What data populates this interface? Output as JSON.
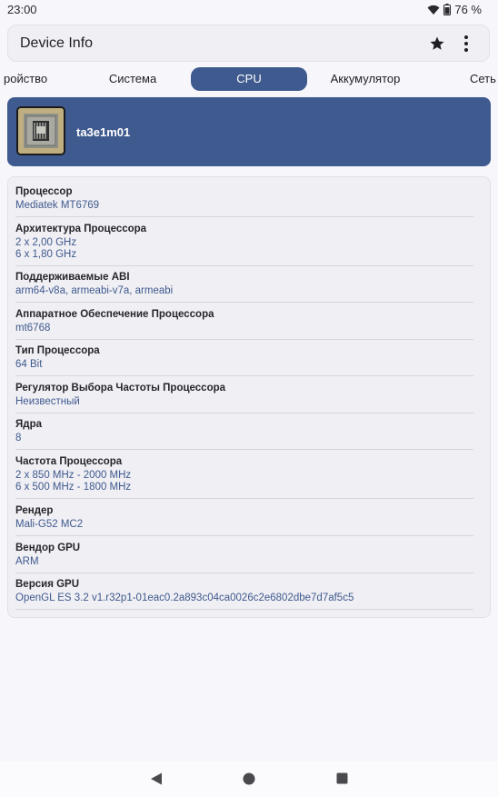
{
  "status": {
    "time": "23:00",
    "battery": "76 %"
  },
  "appbar": {
    "title": "Device Info"
  },
  "tabs": [
    {
      "label": "ройство"
    },
    {
      "label": "Система"
    },
    {
      "label": "CPU",
      "active": true
    },
    {
      "label": "Аккумулятор"
    },
    {
      "label": "Сеть"
    }
  ],
  "header": {
    "device_name": "ta3e1m01"
  },
  "rows": [
    {
      "label": "Процессор",
      "values": [
        "Mediatek MT6769"
      ]
    },
    {
      "label": "Архитектура Процессора",
      "values": [
        "2 x 2,00 GHz",
        "6 x 1,80 GHz"
      ]
    },
    {
      "label": "Поддерживаемые ABI",
      "values": [
        "arm64-v8a, armeabi-v7a, armeabi"
      ]
    },
    {
      "label": "Аппаратное Обеспечение Процессора",
      "values": [
        "mt6768"
      ]
    },
    {
      "label": "Тип Процессора",
      "values": [
        "64 Bit"
      ]
    },
    {
      "label": "Регулятор Выбора Частоты Процессора",
      "values": [
        "Неизвестный"
      ]
    },
    {
      "label": "Ядра",
      "values": [
        "8"
      ]
    },
    {
      "label": "Частота Процессора",
      "values": [
        "2 x 850 MHz - 2000 MHz",
        "6 x 500 MHz - 1800 MHz"
      ]
    },
    {
      "label": "Рендер",
      "values": [
        "Mali-G52 MC2"
      ]
    },
    {
      "label": "Вендор GPU",
      "values": [
        "ARM"
      ]
    },
    {
      "label": "Версия GPU",
      "values": [
        "OpenGL ES 3.2 v1.r32p1-01eac0.2a893c04ca0026c2e6802dbe7d7af5c5"
      ]
    }
  ],
  "icons": {
    "wifi": "wifi-icon",
    "battery": "battery-icon",
    "star": "star-icon",
    "more": "more-vert-icon",
    "chip": "cpu-chip-icon",
    "back": "back-icon",
    "home": "home-icon",
    "recents": "recents-icon"
  },
  "colors": {
    "accent": "#3f5a8e",
    "background": "#f7f6fb",
    "card": "#f0eff4"
  }
}
